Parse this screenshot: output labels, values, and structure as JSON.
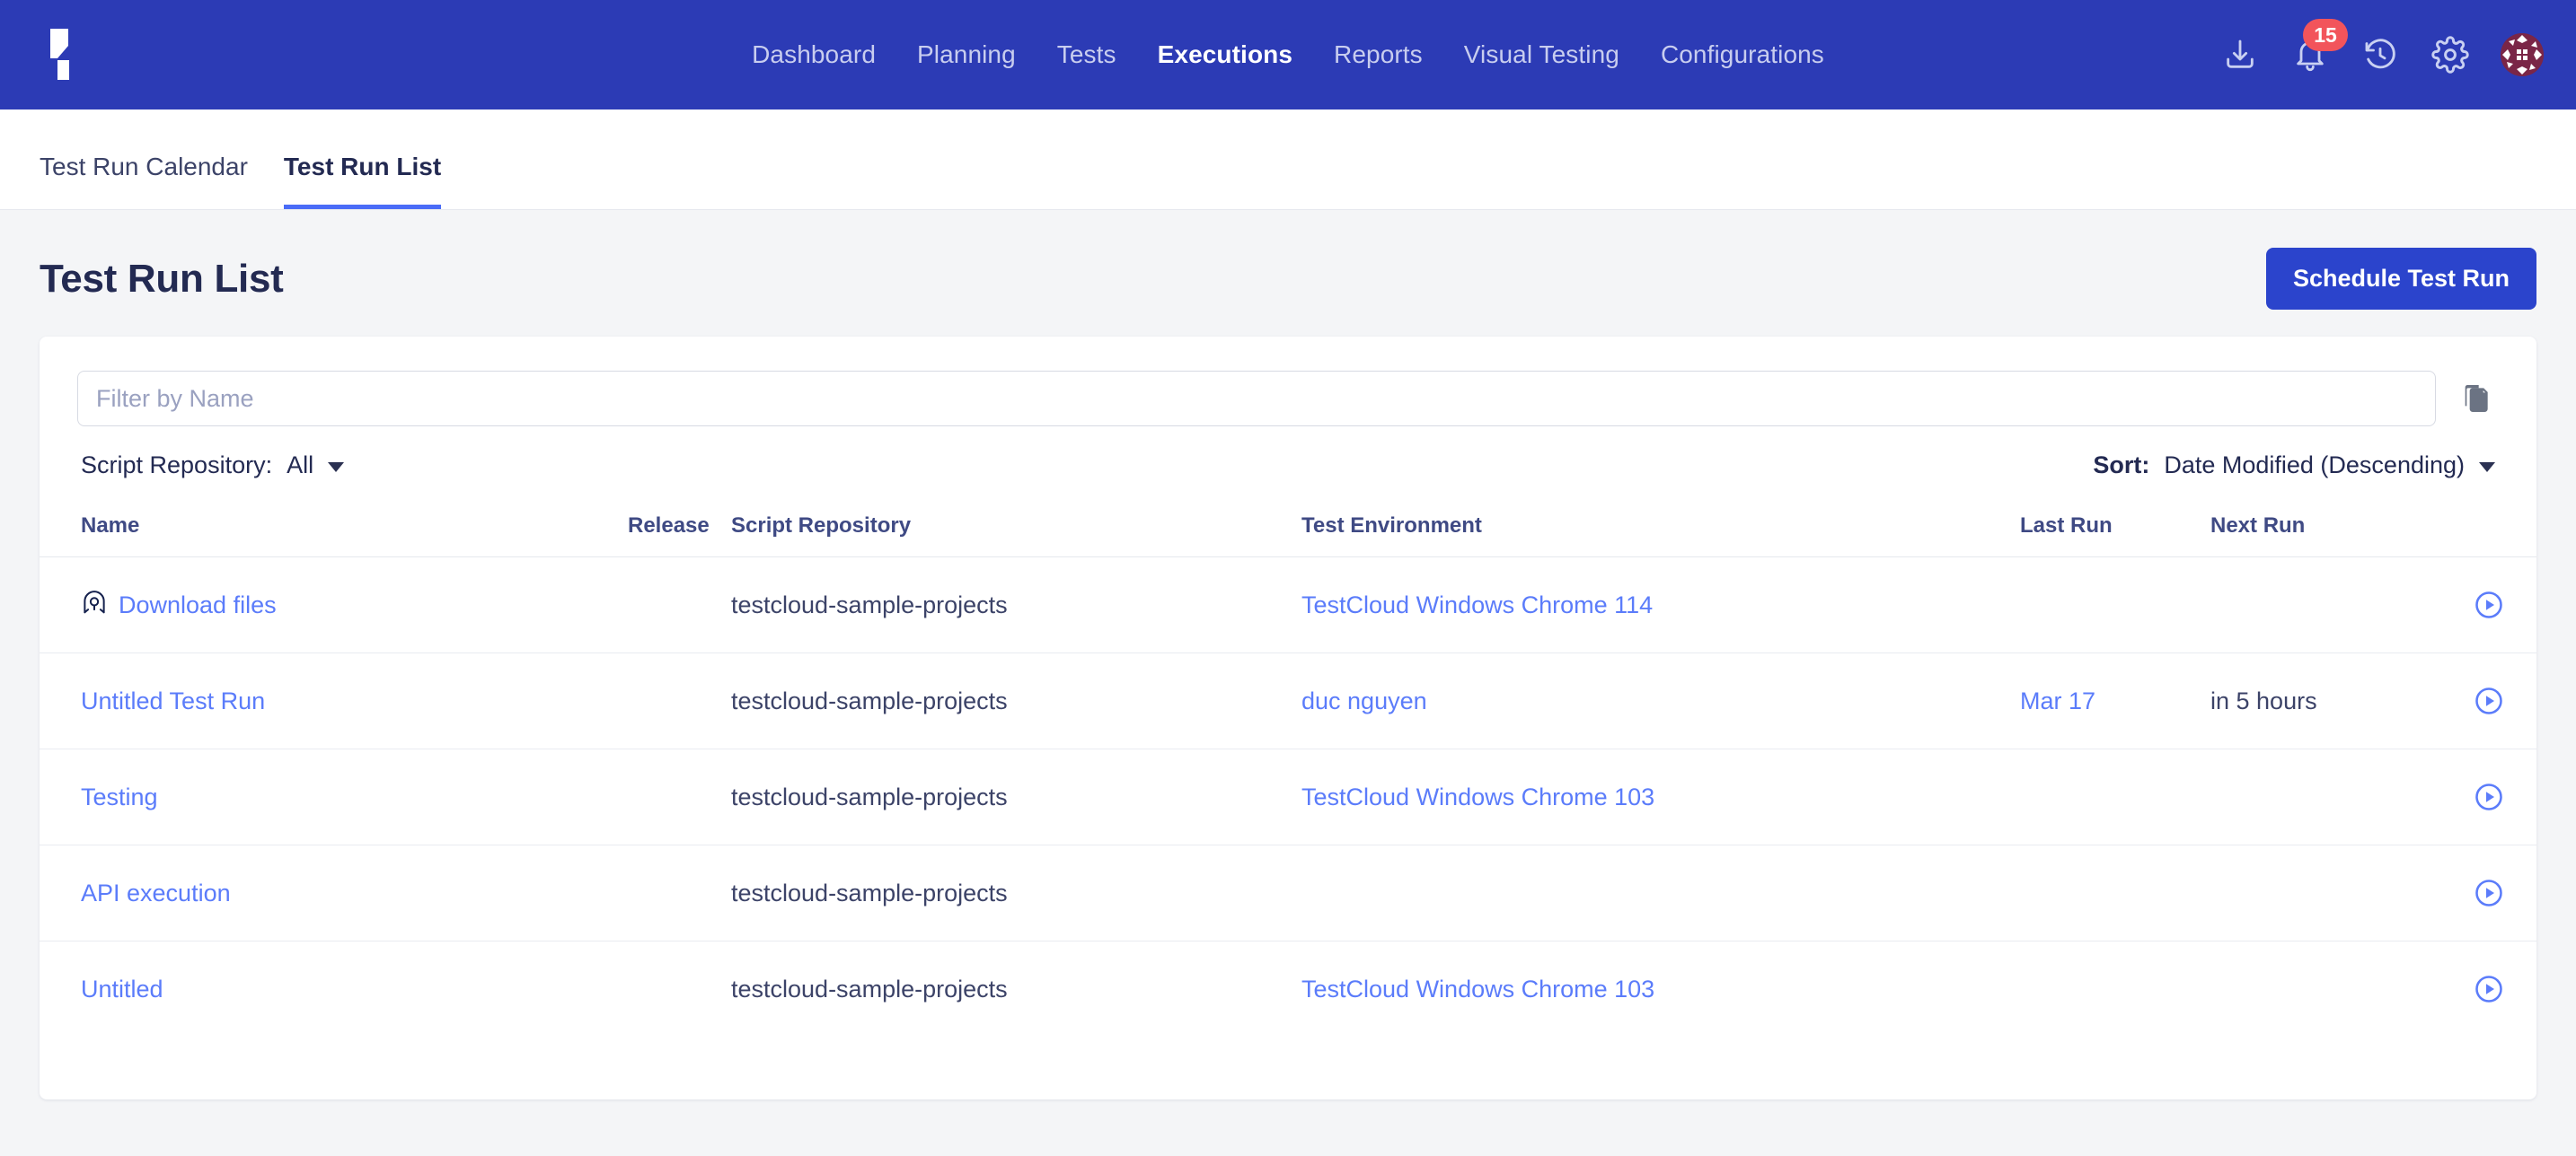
{
  "colors": {
    "nav_bg": "#2c3bb5",
    "accent": "#2b44cc",
    "link": "#5b7cfa",
    "badge": "#f2545b",
    "page_bg": "#f4f5f7",
    "avatar": "#7a2647"
  },
  "topnav": {
    "logo_name": "katalon-logo",
    "items": [
      {
        "label": "Dashboard",
        "active": false
      },
      {
        "label": "Planning",
        "active": false
      },
      {
        "label": "Tests",
        "active": false
      },
      {
        "label": "Executions",
        "active": true
      },
      {
        "label": "Reports",
        "active": false
      },
      {
        "label": "Visual Testing",
        "active": false
      },
      {
        "label": "Configurations",
        "active": false
      }
    ],
    "icons": {
      "download": "download-icon",
      "notifications": "bell-icon",
      "history": "history-icon",
      "settings": "gear-icon",
      "avatar": "avatar"
    },
    "notification_count": "15"
  },
  "tabs": [
    {
      "label": "Test Run Calendar",
      "active": false
    },
    {
      "label": "Test Run List",
      "active": true
    }
  ],
  "page": {
    "title": "Test Run List",
    "primary_button": "Schedule Test Run"
  },
  "filters": {
    "name_placeholder": "Filter by Name",
    "name_value": "",
    "copy_icon": "copy-icon",
    "repository": {
      "label": "Script Repository:",
      "value": "All"
    },
    "sort": {
      "label": "Sort:",
      "value": "Date Modified (Descending)"
    }
  },
  "table": {
    "headers": {
      "name": "Name",
      "release": "Release",
      "repository": "Script Repository",
      "environment": "Test Environment",
      "last_run": "Last Run",
      "next_run": "Next Run",
      "action": ""
    },
    "rows": [
      {
        "name": "Download files",
        "has_private_icon": true,
        "release": "",
        "repository": "testcloud-sample-projects",
        "environment": "TestCloud Windows Chrome 114",
        "last_run": "",
        "next_run": "",
        "action": "run-icon"
      },
      {
        "name": "Untitled Test Run",
        "has_private_icon": false,
        "release": "",
        "repository": "testcloud-sample-projects",
        "environment": "duc nguyen",
        "last_run": "Mar 17",
        "next_run": "in 5 hours",
        "action": "run-icon"
      },
      {
        "name": "Testing",
        "has_private_icon": false,
        "release": "",
        "repository": "testcloud-sample-projects",
        "environment": "TestCloud Windows Chrome 103",
        "last_run": "",
        "next_run": "",
        "action": "run-icon"
      },
      {
        "name": "API execution",
        "has_private_icon": false,
        "release": "",
        "repository": "testcloud-sample-projects",
        "environment": "",
        "last_run": "",
        "next_run": "",
        "action": "run-icon"
      },
      {
        "name": "Untitled",
        "has_private_icon": false,
        "release": "",
        "repository": "testcloud-sample-projects",
        "environment": "TestCloud Windows Chrome 103",
        "last_run": "",
        "next_run": "",
        "action": "run-icon"
      }
    ]
  }
}
